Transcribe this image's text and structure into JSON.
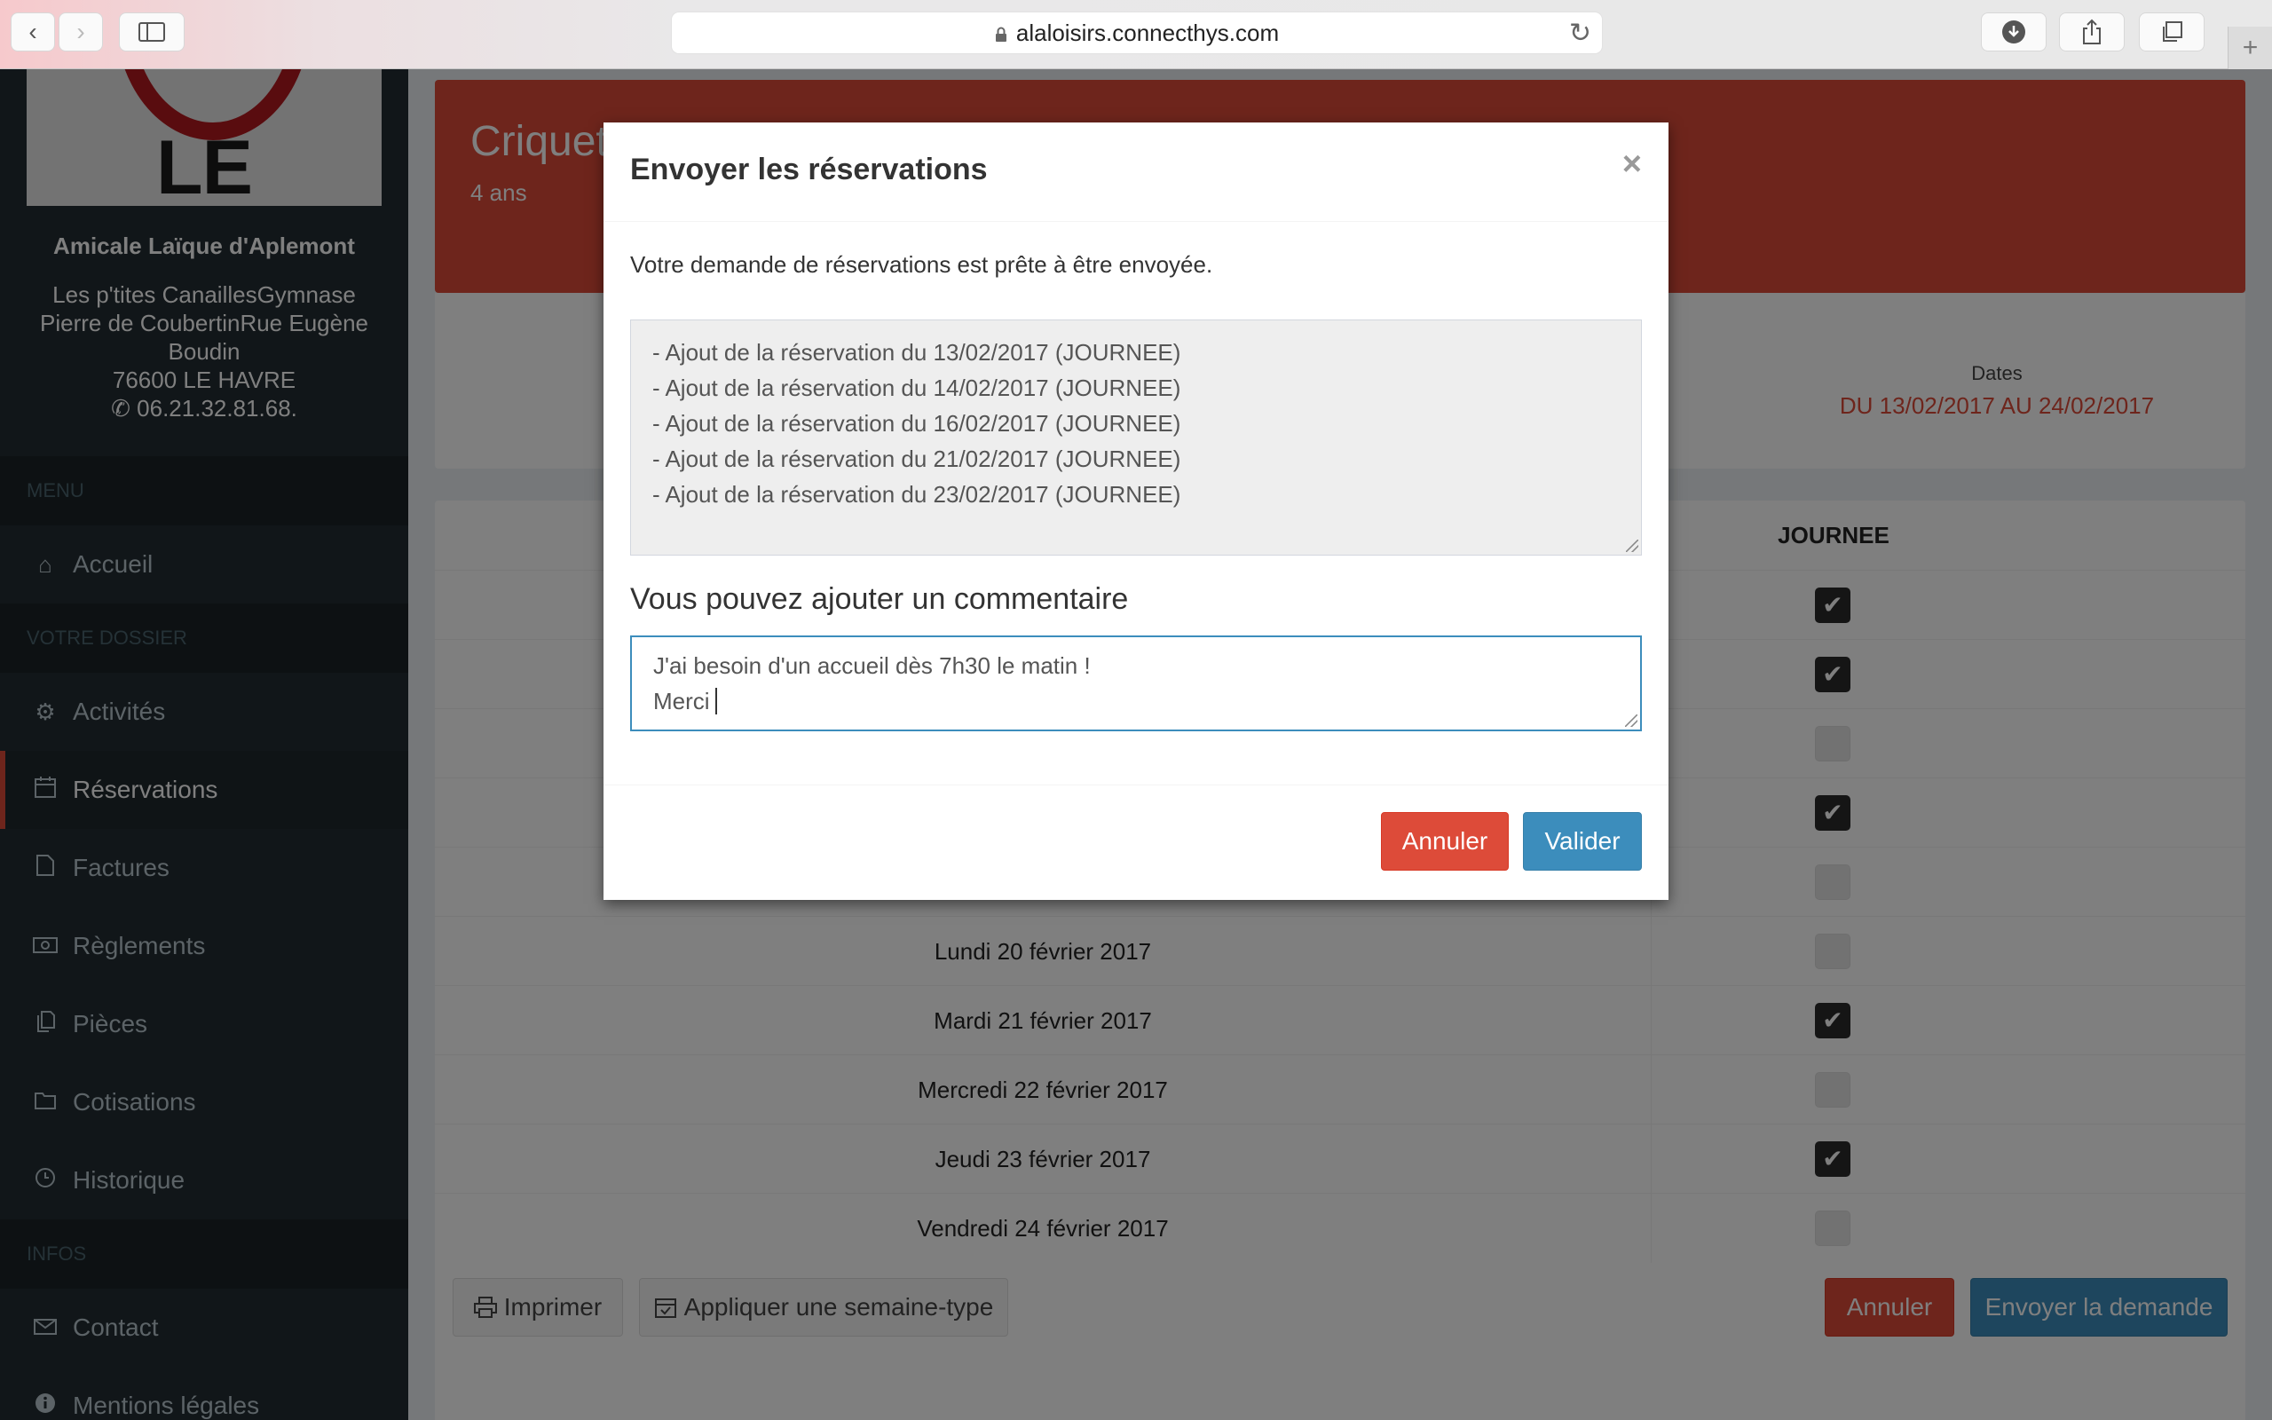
{
  "browser": {
    "url": "alaloisirs.connecthys.com",
    "back_icon": "‹",
    "forward_icon": "›",
    "reload_icon": "↻",
    "plus_icon": "+"
  },
  "sidebar": {
    "logo_text": "LE HAVRE",
    "org_name": "Amicale Laïque d'Aplemont",
    "address_line1": "Les p'tites CanaillesGymnase Pierre de CoubertinRue Eugène Boudin",
    "address_line2": "76600 LE HAVRE",
    "phone": "06.21.32.81.68.",
    "menu_header": "MENU",
    "dossier_header": "VOTRE DOSSIER",
    "infos_header": "INFOS",
    "items": [
      {
        "label": "Accueil",
        "icon": "home-icon"
      },
      {
        "label": "Activités",
        "icon": "gears-icon"
      },
      {
        "label": "Réservations",
        "icon": "calendar-icon"
      },
      {
        "label": "Factures",
        "icon": "file-icon"
      },
      {
        "label": "Règlements",
        "icon": "money-icon"
      },
      {
        "label": "Pièces",
        "icon": "files-icon"
      },
      {
        "label": "Cotisations",
        "icon": "folder-icon"
      },
      {
        "label": "Historique",
        "icon": "clock-icon"
      },
      {
        "label": "Contact",
        "icon": "envelope-icon"
      },
      {
        "label": "Mentions légales",
        "icon": "info-icon"
      }
    ]
  },
  "main": {
    "activity_title": "Criquet",
    "activity_age": "4 ans",
    "dates_label": "Dates",
    "dates_value": "DU 13/02/2017 AU 24/02/2017",
    "column_header": "JOURNEE",
    "rows": [
      {
        "day": "",
        "checked": true
      },
      {
        "day": "",
        "checked": true
      },
      {
        "day": "",
        "checked": false
      },
      {
        "day": "",
        "checked": true
      },
      {
        "day": "",
        "checked": false
      },
      {
        "day": "Lundi 20 février 2017",
        "checked": false
      },
      {
        "day": "Mardi 21 février 2017",
        "checked": true
      },
      {
        "day": "Mercredi 22 février 2017",
        "checked": false
      },
      {
        "day": "Jeudi 23 février 2017",
        "checked": true
      },
      {
        "day": "Vendredi 24 février 2017",
        "checked": false
      }
    ],
    "print_label": "Imprimer",
    "week_label": "Appliquer une semaine-type",
    "cancel_label": "Annuler",
    "send_label": "Envoyer la demande"
  },
  "modal": {
    "title": "Envoyer les réservations",
    "close": "×",
    "intro": "Votre demande de réservations est prête à être envoyée.",
    "summary_lines": [
      "- Ajout de la réservation du 13/02/2017 (JOURNEE)",
      "- Ajout de la réservation du 14/02/2017 (JOURNEE)",
      "- Ajout de la réservation du 16/02/2017 (JOURNEE)",
      "- Ajout de la réservation du 21/02/2017 (JOURNEE)",
      "- Ajout de la réservation du 23/02/2017 (JOURNEE)"
    ],
    "comment_label": "Vous pouvez ajouter un commentaire",
    "comment_line1": "J'ai besoin d'un accueil dès 7h30 le matin !",
    "comment_line2": "Merci",
    "cancel_label": "Annuler",
    "validate_label": "Valider"
  },
  "colors": {
    "accent_red": "#dd4b39",
    "accent_blue": "#3c8dbc",
    "sidebar_bg": "#222d32"
  }
}
